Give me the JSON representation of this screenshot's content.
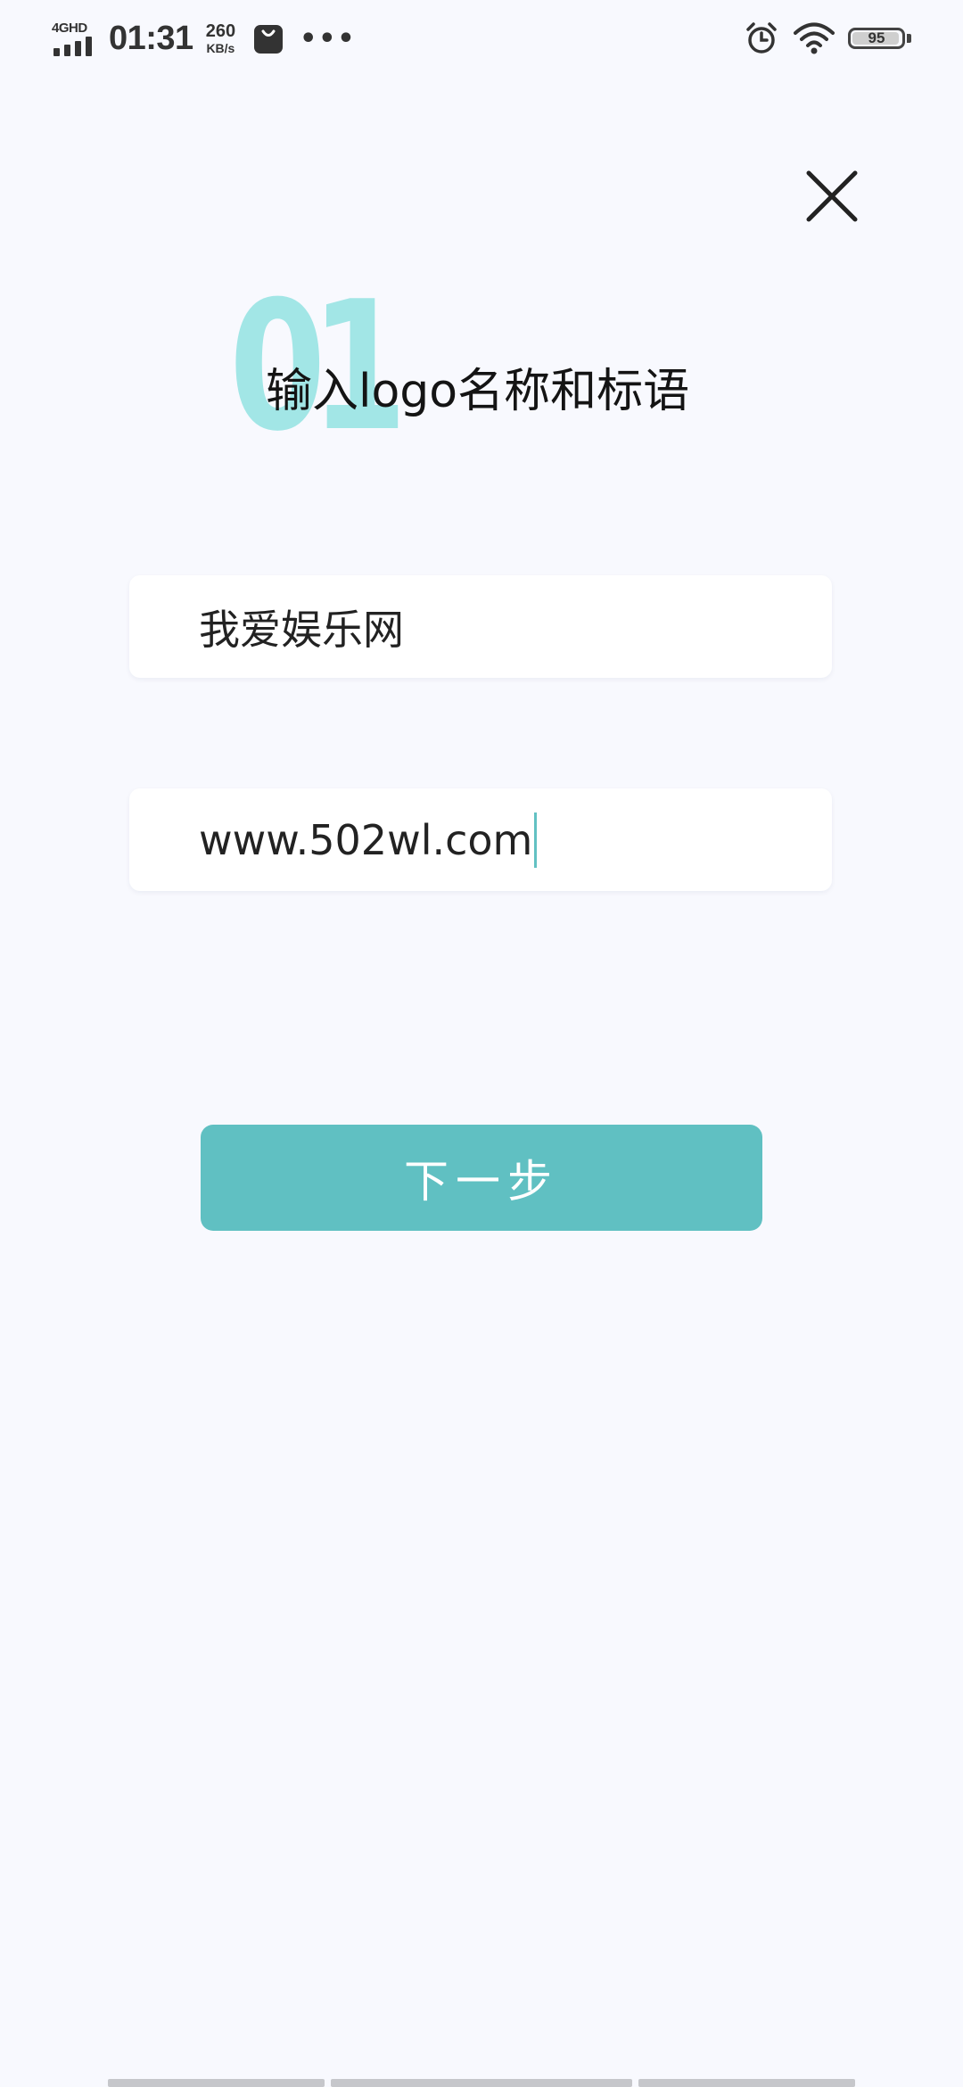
{
  "status_bar": {
    "network_type": "4GHD",
    "time": "01:31",
    "speed_value": "260",
    "speed_unit": "KB/s",
    "more": "•••",
    "battery_level": "95"
  },
  "title": {
    "step_number": "01",
    "text": "输入logo名称和标语"
  },
  "form": {
    "logo_name_value": "我爱娱乐网",
    "slogan_value": "www.502wl.com"
  },
  "actions": {
    "next_label": "下一步"
  },
  "colors": {
    "accent": "#60c0c2",
    "step_number": "#a2e6e6",
    "background": "#f8f9fe"
  }
}
